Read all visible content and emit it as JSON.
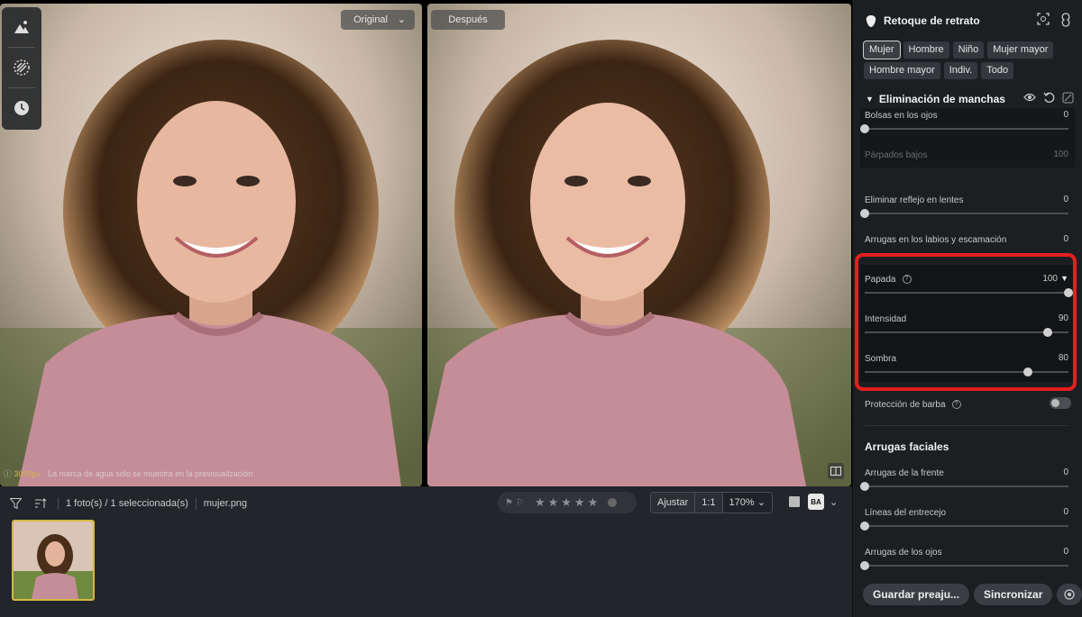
{
  "compare": {
    "before_label": "Original",
    "after_label": "Después",
    "watermark_size": "3000px",
    "watermark_note": "· La marca de agua solo se muestra en la previsualización"
  },
  "toolbar": {
    "selection": "1 foto(s) / 1 seleccionada(s)",
    "filename": "mujer.png",
    "zoom_fit": "Ajustar",
    "zoom_1to1": "1:1",
    "zoom_level": "170%",
    "rating_stars": 0,
    "ba_label": "BA"
  },
  "panel": {
    "title": "Retoque de retrato",
    "chips": [
      {
        "label": "Mujer",
        "selected": true
      },
      {
        "label": "Hombre",
        "selected": false
      },
      {
        "label": "Niño",
        "selected": false
      },
      {
        "label": "Mujer mayor",
        "selected": false
      },
      {
        "label": "Hombre mayor",
        "selected": false
      },
      {
        "label": "Indiv.",
        "selected": false
      },
      {
        "label": "Todo",
        "selected": false
      }
    ],
    "section_title": "Eliminación de manchas",
    "sliders": {
      "bolsas": {
        "label": "Bolsas en los ojos",
        "value": "0",
        "level": 0
      },
      "parpados": {
        "label": "Párpados bajos",
        "value": "100",
        "level": 100
      },
      "reflejo": {
        "label": "Eliminar reflejo en lentes",
        "value": "0",
        "level": 0
      },
      "labios": {
        "label": "Arrugas en los labios y escamación",
        "value": "0",
        "level": 0
      },
      "papada": {
        "label": "Papada",
        "value": "100",
        "level": 100
      },
      "intensidad": {
        "label": "Intensidad",
        "value": "90",
        "level": 90
      },
      "sombra": {
        "label": "Sombra",
        "value": "80",
        "level": 80
      },
      "frente": {
        "label": "Arrugas de la frente",
        "value": "0",
        "level": 0
      },
      "entrecejo": {
        "label": "Líneas del entrecejo",
        "value": "0",
        "level": 0
      },
      "ojos": {
        "label": "Arrugas de los ojos",
        "value": "0",
        "level": 0
      }
    },
    "barba_label": "Protección de barba",
    "wrinkles_title": "Arrugas faciales",
    "save_label": "Guardar preaju...",
    "sync_label": "Sincronizar"
  }
}
